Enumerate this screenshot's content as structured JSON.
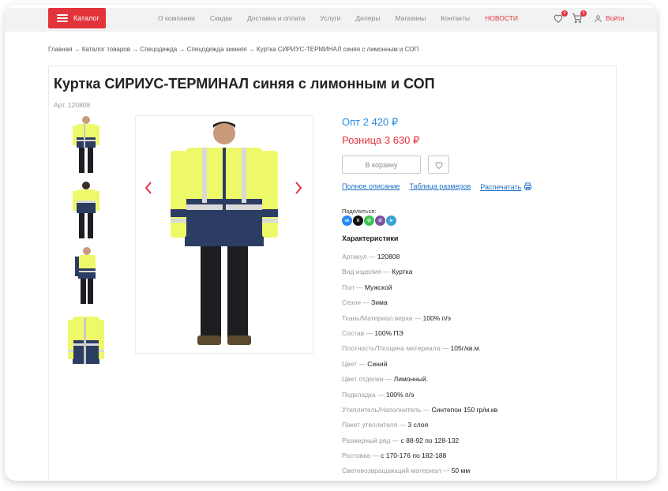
{
  "header": {
    "catalog_label": "Каталог",
    "nav": [
      "О компании",
      "Скидки",
      "Доставка и оплата",
      "Услуги",
      "Дилеры",
      "Магазины",
      "Контакты"
    ],
    "nav_news": "НОВОСТИ",
    "favorites_count": "0",
    "cart_count": "0",
    "login_label": "Войти",
    "accent_color": "#e3333b"
  },
  "breadcrumb": "Главная → Каталог товаров → Спецодежда → Спецодежда зимняя → Куртка СИРИУС-ТЕРМИНАЛ синяя с лимонным и СОП",
  "product": {
    "title": "Куртка СИРИУС-ТЕРМИНАЛ синяя с лимонным и СОП",
    "article": "Арт. 120808",
    "price_opt": "Опт 2 420 ₽",
    "price_retail": "Розница 3 630 ₽",
    "add_to_cart_label": "В корзину",
    "links": {
      "full_description": "Полное описание",
      "size_table": "Таблица размеров",
      "print": "Распечатать"
    },
    "share_label": "Поделиться:",
    "share_icons": [
      "vk-icon",
      "x-icon",
      "whatsapp-icon",
      "viber-icon",
      "telegram-icon"
    ],
    "characteristics_title": "Характеристики",
    "specs": [
      {
        "k": "Артикул — ",
        "v": "120808"
      },
      {
        "k": "Вид изделия — ",
        "v": "Куртка"
      },
      {
        "k": "Пол — ",
        "v": "Мужской"
      },
      {
        "k": "Сезон — ",
        "v": "Зима"
      },
      {
        "k": "Ткань/Материал верха — ",
        "v": "100% п/э"
      },
      {
        "k": "Состав — ",
        "v": "100% ПЭ"
      },
      {
        "k": "Плотность/Толщина материала — ",
        "v": "105г/кв.м."
      },
      {
        "k": "Цвет — ",
        "v": "Синий"
      },
      {
        "k": "Цвет отделки — ",
        "v": "Лимонный."
      },
      {
        "k": "Подкладка — ",
        "v": "100% п/э"
      },
      {
        "k": "Утеплитель/Наполнитель — ",
        "v": "Синтепон 150 гр/м.кв"
      },
      {
        "k": "Пакет утеплителя — ",
        "v": "3 слоя"
      },
      {
        "k": "Размерный ряд — ",
        "v": "с 88-92 по 128-132"
      },
      {
        "k": "Ростовка — ",
        "v": "с 170-176 по 182-188"
      },
      {
        "k": "Световозвращающий материал — ",
        "v": "50 мм"
      }
    ]
  }
}
